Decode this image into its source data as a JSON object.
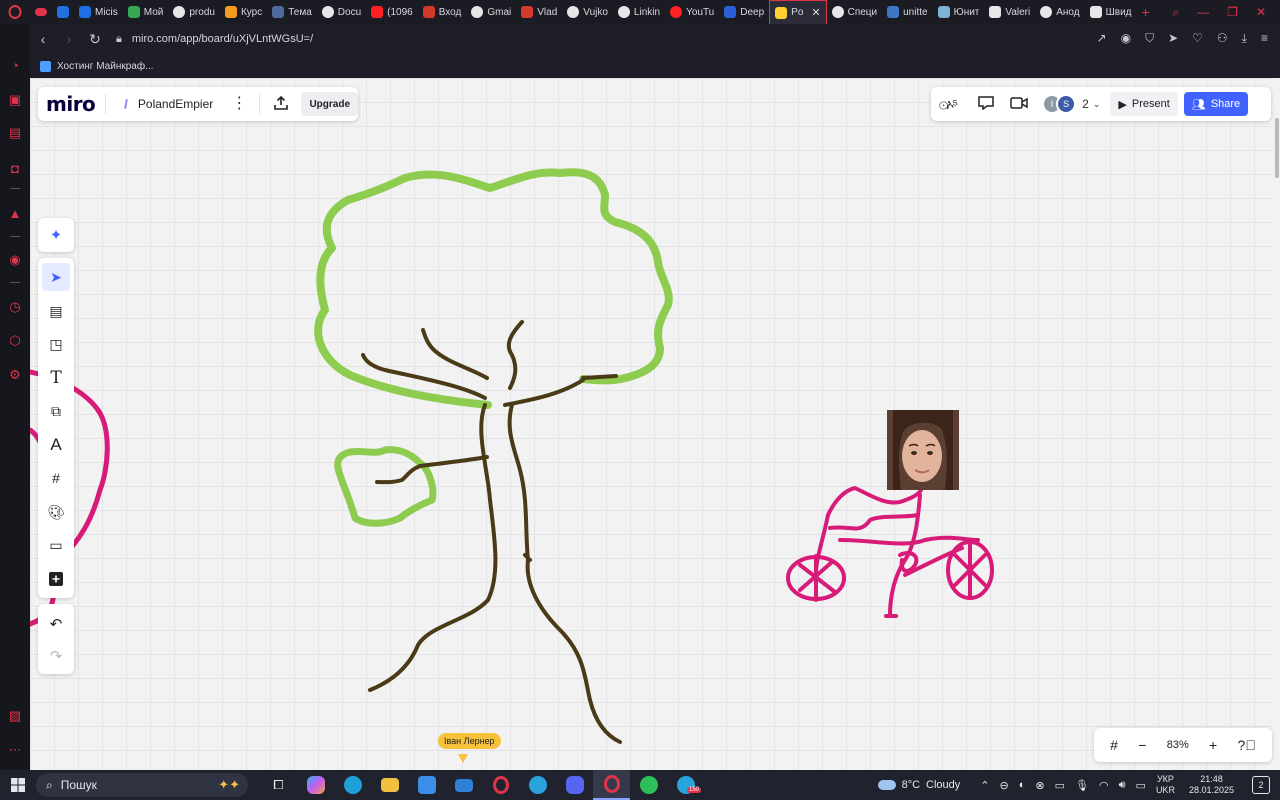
{
  "browser": {
    "tabs": [
      {
        "label": "Micis",
        "color": "#1f6fe5"
      },
      {
        "label": "Мой",
        "color": "#34a853"
      },
      {
        "label": "produ",
        "color": "#e7e7ea"
      },
      {
        "label": "Курс",
        "color": "#f59b1e"
      },
      {
        "label": "Тема",
        "color": "#4e6a9a"
      },
      {
        "label": "Docu",
        "color": "#e7e7ea"
      },
      {
        "label": "(1096",
        "color": "#ff2222"
      },
      {
        "label": "Вход",
        "color": "#d33a2c"
      },
      {
        "label": "Gmai",
        "color": "#e7e7ea"
      },
      {
        "label": "Vlad",
        "color": "#d33a2c"
      },
      {
        "label": "Vujko",
        "color": "#e7e7ea"
      },
      {
        "label": "Linkin",
        "color": "#e7e7ea"
      },
      {
        "label": "YouTu",
        "color": "#ff2222"
      },
      {
        "label": "Deep",
        "color": "#2b5fd9"
      }
    ],
    "active_tab": {
      "label": "Po",
      "close": "✕"
    },
    "tabs_after": [
      {
        "label": "Специ",
        "color": "#e7e7ea"
      },
      {
        "label": "unitte",
        "color": "#3d78c8"
      },
      {
        "label": "Юнит",
        "color": "#7fb3d5"
      },
      {
        "label": "Valeri",
        "color": "#e7e7ea"
      },
      {
        "label": "Анод",
        "color": "#e7e7ea"
      },
      {
        "label": "Швид",
        "color": "#e7e7ea"
      }
    ],
    "new_tab": "+",
    "url": "miro.com/app/board/uXjVLntWGsU=/",
    "bookmark": "Хостинг Майнкраф..."
  },
  "miro": {
    "logo": "miro",
    "board_name": "PolandEmpier",
    "upgrade_label": "Upgrade",
    "avatar_initial": "I",
    "avatar2_initial": "S",
    "collaborator_count": "2",
    "present_label": "Present",
    "share_label": "Share",
    "zoom_level": "83%",
    "cursor_user": "Іван Лернер"
  },
  "taskbar": {
    "search_placeholder": "Пошук",
    "weather_temp": "8°C",
    "weather_text": "Cloudy",
    "lang_line1": "УКР",
    "lang_line2": "UKR",
    "time": "21:48",
    "date": "28.01.2025",
    "notif_count": "2",
    "telegram_badge": "150"
  },
  "colors": {
    "accent": "#4262ff",
    "opera_red": "#e0344b",
    "tree_leaves": "#8dcc4f",
    "tree_trunk": "#4a3a16",
    "bike": "#d81b78"
  }
}
